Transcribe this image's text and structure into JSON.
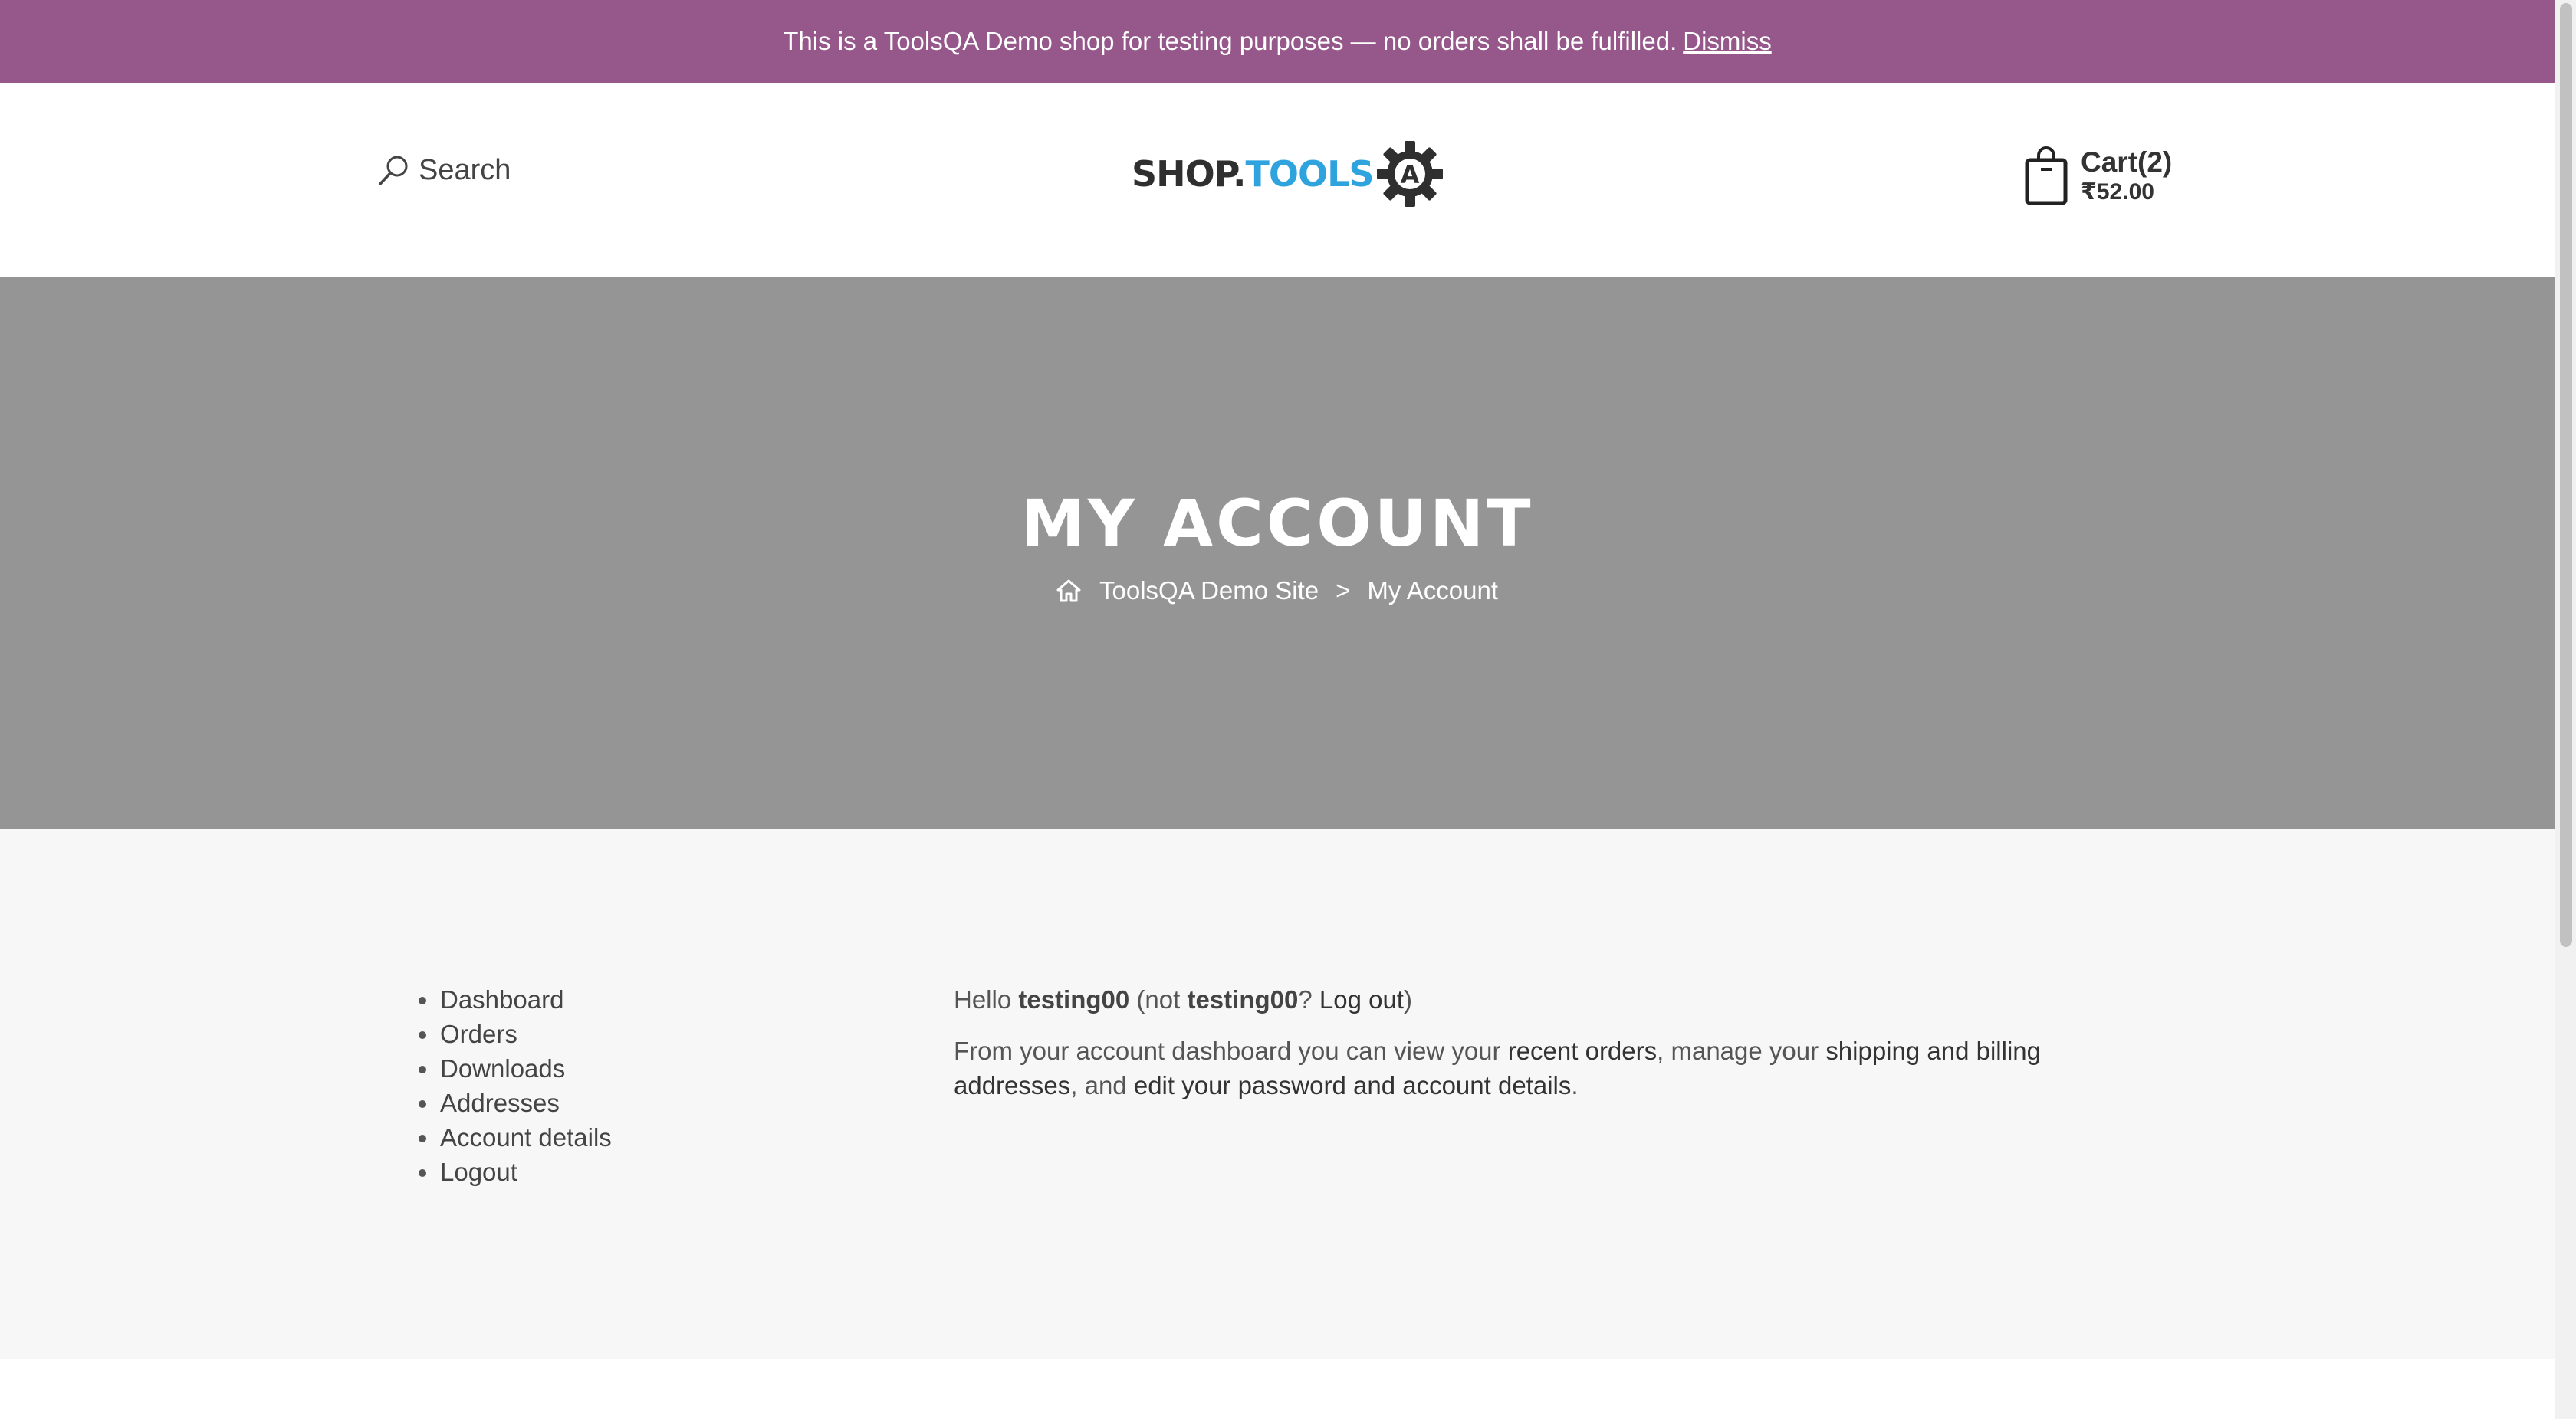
{
  "notice": {
    "text": "This is a ToolsQA Demo shop for testing purposes — no orders shall be fulfilled.",
    "dismiss": "Dismiss",
    "color": "#96588a"
  },
  "header": {
    "search_label": "Search",
    "logo": {
      "part1": "SHOP.",
      "part2": "TOOLS",
      "badge_letter": "A",
      "accent_color": "#2ea3dd"
    },
    "cart": {
      "label": "Cart(2)",
      "total": "₹52.00"
    }
  },
  "hero": {
    "title": "MY ACCOUNT",
    "background": "#959595",
    "breadcrumb": {
      "home_icon": "home-icon",
      "home": "ToolsQA Demo Site",
      "separator": ">",
      "current": "My Account"
    }
  },
  "account_nav": {
    "items": [
      {
        "label": "Dashboard"
      },
      {
        "label": "Orders"
      },
      {
        "label": "Downloads"
      },
      {
        "label": "Addresses"
      },
      {
        "label": "Account details"
      },
      {
        "label": "Logout"
      }
    ]
  },
  "dashboard": {
    "hello": "Hello",
    "username": "testing00",
    "not_open": "(not",
    "username2": "testing00",
    "question": "?",
    "logout_link": "Log out",
    "close_paren": ")",
    "intro": "From your account dashboard you can view your",
    "recent_orders": "recent orders",
    "manage": ", manage your",
    "addresses": "shipping and billing addresses",
    "and": ", and",
    "account_details": "edit your password and account details",
    "period": "."
  }
}
